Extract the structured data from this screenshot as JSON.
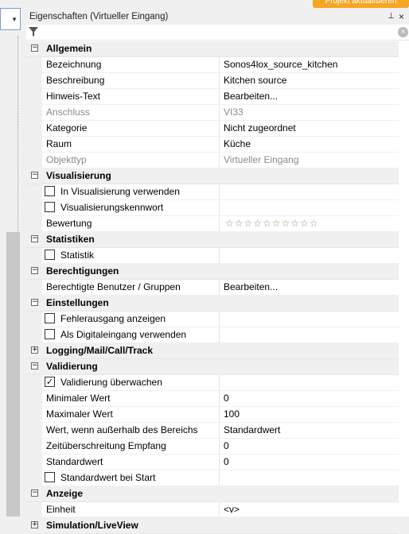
{
  "panel": {
    "title": "Eigenschaften (Virtueller Eingang)",
    "pin_glyph": "↑́",
    "close_glyph": "×",
    "top_button_label": "Projekt aktualisieren"
  },
  "icons": {
    "filter": "filter-icon",
    "clear": "clear-filter-icon",
    "pin": "pin-icon",
    "close": "close-icon",
    "expand": "plus-icon",
    "collapse": "minus-icon",
    "check": "checkmark-icon"
  },
  "colors": {
    "category_bg": "#f0f0f0",
    "disabled_text": "#8a8a8a",
    "accent_orange": "#f5a623"
  },
  "sections": [
    {
      "label": "Allgemein",
      "expanded": true,
      "rows": [
        {
          "name": "Bezeichnung",
          "value": "Sonos4lox_source_kitchen"
        },
        {
          "name": "Beschreibung",
          "value": "Kitchen source"
        },
        {
          "name": "Hinweis-Text",
          "value": "Bearbeiten..."
        },
        {
          "name": "Anschluss",
          "value": "VI33",
          "disabled": true
        },
        {
          "name": "Kategorie",
          "value": "Nicht zugeordnet"
        },
        {
          "name": "Raum",
          "value": "Küche"
        },
        {
          "name": "Objekttyp",
          "value": "Virtueller Eingang",
          "disabled": true
        }
      ]
    },
    {
      "label": "Visualisierung",
      "expanded": true,
      "rows": [
        {
          "name": "In Visualisierung verwenden",
          "checkbox": true,
          "checked": false
        },
        {
          "name": "Visualisierungskennwort",
          "checkbox": true,
          "checked": false
        },
        {
          "name": "Bewertung",
          "rating": "☆☆☆☆☆☆☆☆☆☆"
        }
      ]
    },
    {
      "label": "Statistiken",
      "expanded": true,
      "rows": [
        {
          "name": "Statistik",
          "checkbox": true,
          "checked": false
        }
      ]
    },
    {
      "label": "Berechtigungen",
      "expanded": true,
      "rows": [
        {
          "name": "Berechtigte Benutzer / Gruppen",
          "value": "Bearbeiten..."
        }
      ]
    },
    {
      "label": "Einstellungen",
      "expanded": true,
      "rows": [
        {
          "name": "Fehlerausgang anzeigen",
          "checkbox": true,
          "checked": false
        },
        {
          "name": "Als Digitaleingang verwenden",
          "checkbox": true,
          "checked": false
        }
      ]
    },
    {
      "label": "Logging/Mail/Call/Track",
      "expanded": false,
      "rows": []
    },
    {
      "label": "Validierung",
      "expanded": true,
      "rows": [
        {
          "name": "Validierung überwachen",
          "checkbox": true,
          "checked": true
        },
        {
          "name": "Minimaler Wert",
          "value": "0"
        },
        {
          "name": "Maximaler Wert",
          "value": "100"
        },
        {
          "name": "Wert, wenn außerhalb des Bereichs",
          "value": "Standardwert"
        },
        {
          "name": "Zeitüberschreitung Empfang",
          "value": "0"
        },
        {
          "name": "Standardwert",
          "value": "0"
        },
        {
          "name": "Standardwert bei Start",
          "checkbox": true,
          "checked": false
        }
      ]
    },
    {
      "label": "Anzeige",
      "expanded": true,
      "rows": [
        {
          "name": "Einheit",
          "value": "<v>"
        }
      ]
    },
    {
      "label": "Simulation/LiveView",
      "expanded": false,
      "rows": []
    }
  ]
}
